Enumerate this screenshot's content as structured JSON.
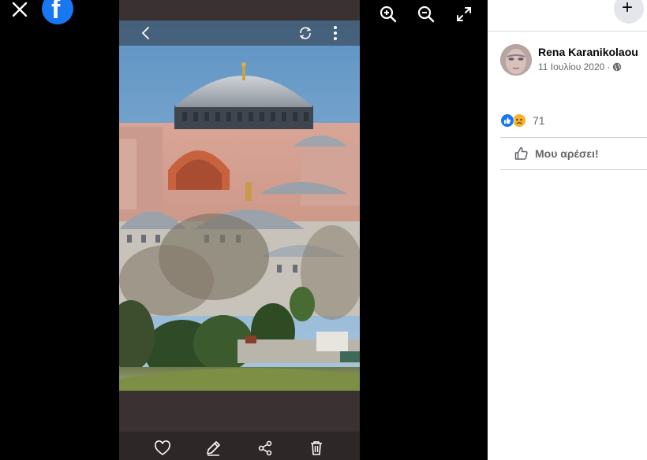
{
  "viewer": {
    "icons": {
      "close": "close-icon",
      "logo": "facebook-logo",
      "zoom_in": "zoom-in-icon",
      "zoom_out": "zoom-out-icon",
      "fullscreen": "fullscreen-icon"
    },
    "logo_letter": "f",
    "phone": {
      "top_icons": [
        "back-arrow-icon",
        "rotate-icon",
        "more-vertical-icon"
      ],
      "bottom_icons": [
        "heart-icon",
        "edit-pencil-icon",
        "share-icon",
        "trash-icon"
      ]
    }
  },
  "side": {
    "plus": "+",
    "author": "Rena Karanikolaou",
    "date": "11 Ιουλίου 2020",
    "separator": "·",
    "reaction_count": "71",
    "like_label": "Μου αρέσει!"
  },
  "colors": {
    "brand": "#1877f2",
    "viewer_bg": "#000000",
    "panel_bg": "#ffffff",
    "muted_text": "#65676b",
    "sad_reaction": "#f7b125"
  }
}
